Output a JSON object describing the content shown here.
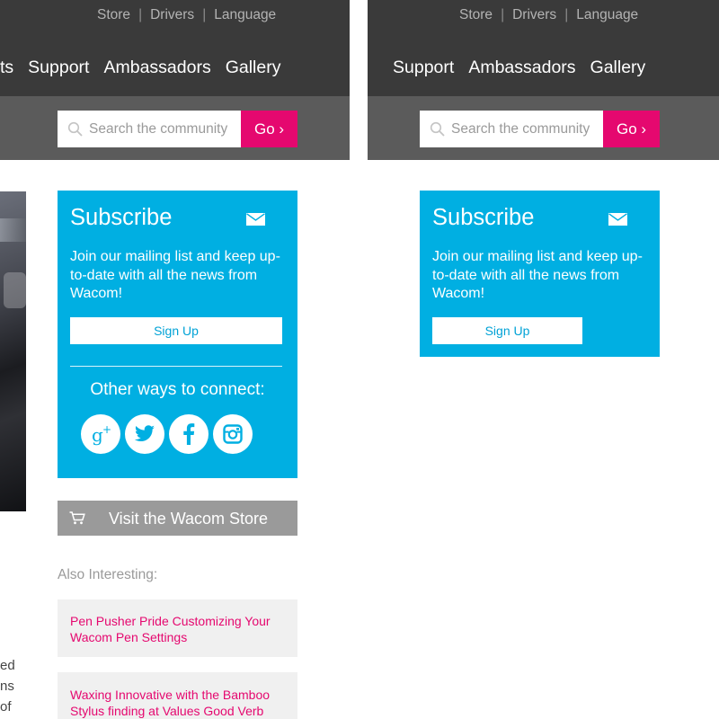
{
  "header": {
    "utility_links": [
      "Store",
      "Drivers",
      "Language"
    ],
    "nav_left": [
      "ts",
      "Support",
      "Ambassadors",
      "Gallery"
    ],
    "nav_right": [
      "Support",
      "Ambassadors",
      "Gallery"
    ]
  },
  "search": {
    "placeholder": "Search the community",
    "go_label": "Go ›",
    "icon": "search-icon"
  },
  "subscribe": {
    "title": "Subscribe",
    "text": "Join our mailing list and keep up-to-date with all the news from Wacom!",
    "button": "Sign Up",
    "icon": "mail-icon"
  },
  "connect": {
    "heading": "Other ways to connect:",
    "networks": [
      "google-plus-icon",
      "twitter-icon",
      "facebook-icon",
      "instagram-icon"
    ]
  },
  "store": {
    "label": "Visit the Wacom Store",
    "icon": "cart-icon"
  },
  "also_interesting": {
    "heading": "Also Interesting:",
    "items": [
      "Pen Pusher Pride Customizing Your Wacom Pen Settings",
      "Waxing Innovative with the Bamboo Stylus finding at Values Good Verb"
    ]
  },
  "article_fragments": [
    "ed",
    "ns",
    "of"
  ],
  "colors": {
    "header_dark": "#3a3a3a",
    "search_bar": "#5b5b5b",
    "accent_pink": "#e5086f",
    "subscribe_blue": "#00afe2",
    "store_gray": "#9a9a9a",
    "card_bg": "#f0f0f0"
  }
}
